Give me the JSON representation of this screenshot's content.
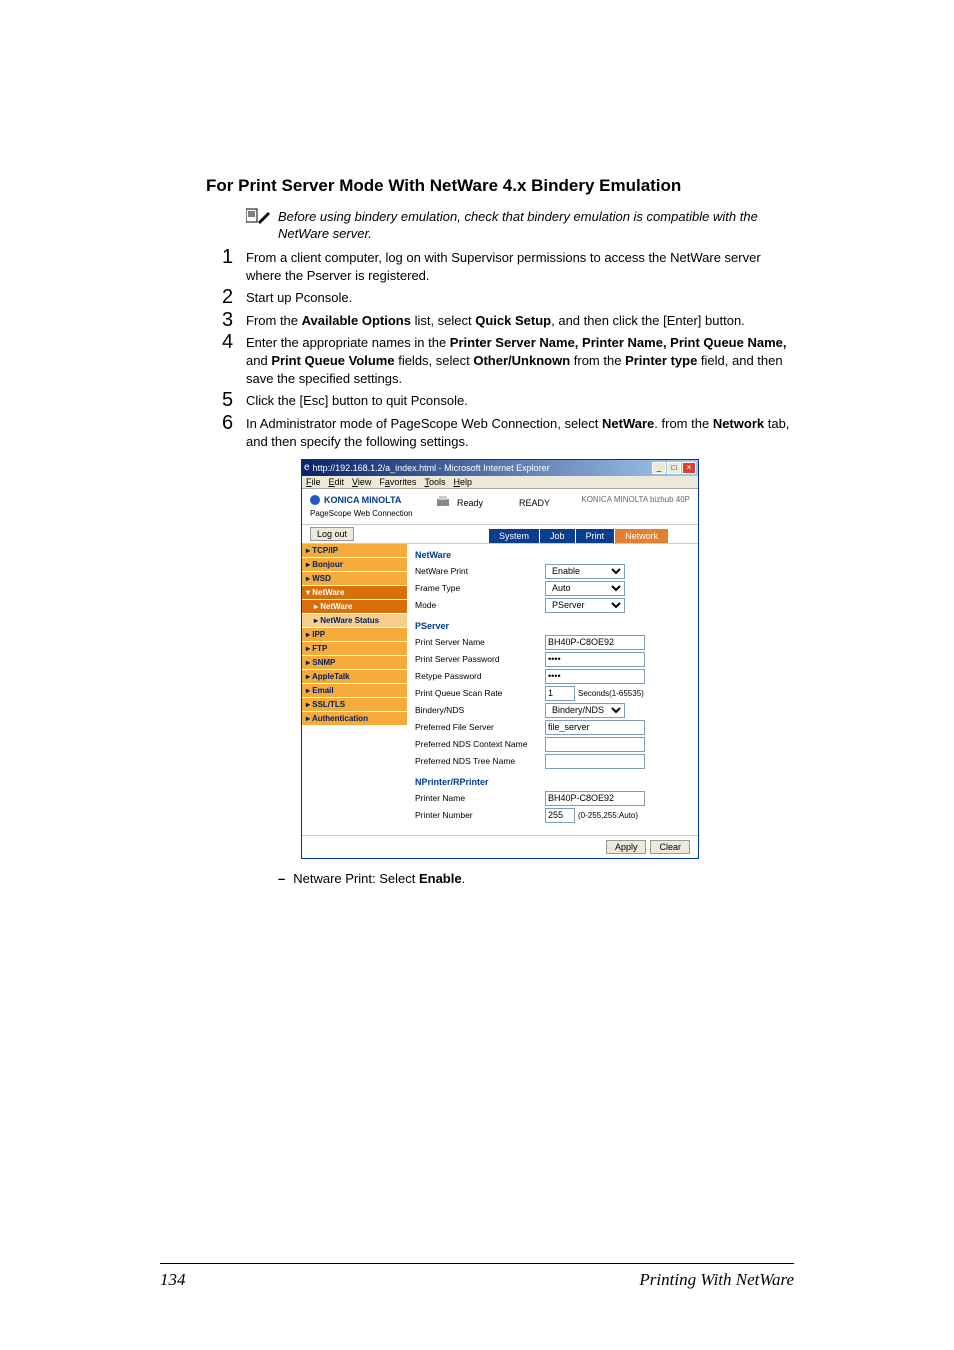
{
  "title": "For Print Server Mode With NetWare 4.x Bindery Emulation",
  "note": "Before using bindery emulation, check that bindery emulation is compatible with the NetWare server.",
  "steps": {
    "s1": "From a client computer, log on with Supervisor permissions to access the NetWare server where the Pserver is registered.",
    "s2": "Start up Pconsole.",
    "s3a": "From the ",
    "s3b": "Available Options",
    "s3c": " list, select ",
    "s3d": "Quick Setup",
    "s3e": ", and then click the [Enter] button.",
    "s4a": "Enter the appropriate names in the ",
    "s4b": "Printer Server Name, Printer Name, Print Queue Name,",
    "s4c": " and ",
    "s4d": "Print Queue Volume",
    "s4e": " fields, select ",
    "s4f": "Other/Unknown",
    "s4g": " from the ",
    "s4h": "Printer type",
    "s4i": " field, and then save the specified settings.",
    "s5": "Click the [Esc] button to quit Pconsole.",
    "s6a": "In Administrator mode of PageScope Web Connection, select ",
    "s6b": "NetWare",
    "s6c": ". from the ",
    "s6d": "Network",
    "s6e": " tab, and then specify the following settings."
  },
  "bullet": {
    "prefix": "Netware Print: Select ",
    "bold": "Enable",
    "suffix": "."
  },
  "footer": {
    "page": "134",
    "section": "Printing With NetWare"
  },
  "screenshot": {
    "titlebar": "http://192.168.1.2/a_index.html - Microsoft Internet Explorer",
    "menus": {
      "file": "File",
      "edit": "Edit",
      "view": "View",
      "fav": "Favorites",
      "tools": "Tools",
      "help": "Help"
    },
    "brand": "KONICA MINOLTA",
    "sub_brand": "PageScope Web Connection",
    "ready_icon": "Ready",
    "ready_text": "READY",
    "model": "KONICA MINOLTA bizhub 40P",
    "logout": "Log out",
    "tabs": {
      "system": "System",
      "job": "Job",
      "print": "Print",
      "network": "Network"
    },
    "side": {
      "tcpip": "TCP/IP",
      "bonjour": "Bonjour",
      "wsd": "WSD",
      "netware": "NetWare",
      "netware_sub": "NetWare",
      "netware_status": "NetWare Status",
      "ipp": "IPP",
      "ftp": "FTP",
      "snmp": "SNMP",
      "appletalk": "AppleTalk",
      "email": "Email",
      "ssl": "SSL/TLS",
      "auth": "Authentication"
    },
    "sections": {
      "netware": "NetWare",
      "pserver": "PServer",
      "nprinter": "NPrinter/RPrinter"
    },
    "labels": {
      "nwprint": "NetWare Print",
      "ftype": "Frame Type",
      "mode": "Mode",
      "psname": "Print Server Name",
      "pspwd": "Print Server Password",
      "repwd": "Retype Password",
      "qscan": "Print Queue Scan Rate",
      "bnds": "Bindery/NDS",
      "pfile": "Preferred File Server",
      "pctx": "Preferred NDS Context Name",
      "ptree": "Preferred NDS Tree Name",
      "pname": "Printer Name",
      "pnum": "Printer Number"
    },
    "values": {
      "nwprint": "Enable",
      "ftype": "Auto",
      "mode": "PServer",
      "psname": "BH40P-C8OE92",
      "pspwd": "••••",
      "repwd": "••••",
      "qscan": "1",
      "qscan_range": "Seconds(1-65535)",
      "bnds": "Bindery/NDS",
      "pfile": "file_server",
      "pctx": "",
      "ptree": "",
      "pname": "BH40P-C8OE92",
      "pnum": "255",
      "pnum_range": "(0-255,255:Auto)"
    },
    "buttons": {
      "apply": "Apply",
      "clear": "Clear"
    }
  }
}
